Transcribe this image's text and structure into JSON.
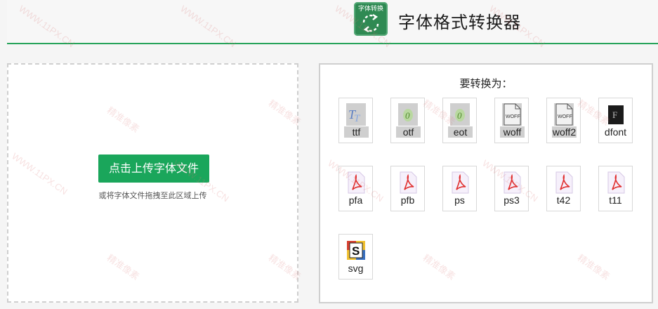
{
  "header": {
    "logo_text": "字体转换",
    "title": "字体格式转换器"
  },
  "upload": {
    "button_label": "点击上传字体文件",
    "hint": "或将字体文件拖拽至此区域上传"
  },
  "panel": {
    "title": "要转换为：",
    "formats": [
      {
        "label": "ttf",
        "icon": "truetype-icon",
        "selected": true
      },
      {
        "label": "otf",
        "icon": "opentype-icon",
        "selected": true
      },
      {
        "label": "eot",
        "icon": "opentype-icon",
        "selected": true
      },
      {
        "label": "woff",
        "icon": "woff-file-icon",
        "selected": true
      },
      {
        "label": "woff2",
        "icon": "woff-file-icon",
        "selected": true
      },
      {
        "label": "dfont",
        "icon": "dfont-icon",
        "selected": false
      },
      {
        "label": "pfa",
        "icon": "pdf-icon",
        "selected": false
      },
      {
        "label": "pfb",
        "icon": "pdf-icon",
        "selected": false
      },
      {
        "label": "ps",
        "icon": "pdf-icon",
        "selected": false
      },
      {
        "label": "ps3",
        "icon": "pdf-icon",
        "selected": false
      },
      {
        "label": "t42",
        "icon": "pdf-icon",
        "selected": false
      },
      {
        "label": "t11",
        "icon": "pdf-icon",
        "selected": false
      },
      {
        "label": "svg",
        "icon": "svg-s-icon",
        "selected": false
      }
    ]
  },
  "watermark": {
    "url_text": "WWW.11PX.CN",
    "brand_text": "精准像素"
  },
  "colors": {
    "accent": "#1aa65b",
    "header_line": "#27a35a",
    "logo_bg": "#2f8a53"
  }
}
